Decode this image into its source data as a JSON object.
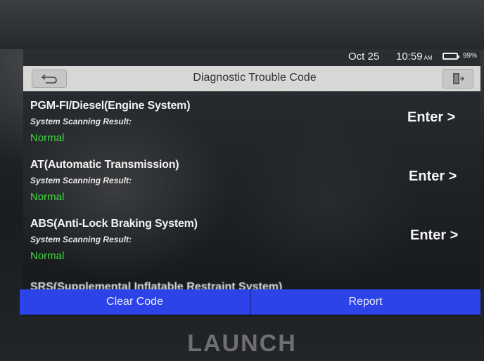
{
  "status_bar": {
    "date": "Oct 25",
    "time": "10:59",
    "ampm": "AM",
    "battery": "99%"
  },
  "header": {
    "title": "Diagnostic Trouble Code",
    "back_icon": "back-arrow-icon",
    "exit_icon": "exit-door-icon"
  },
  "systems": [
    {
      "name": "PGM-FI/Diesel(Engine System)",
      "scan_label": "System Scanning Result:",
      "result": "Normal",
      "action": "Enter >"
    },
    {
      "name": "AT(Automatic Transmission)",
      "scan_label": "System Scanning Result:",
      "result": "Normal",
      "action": "Enter >"
    },
    {
      "name": "ABS(Anti-Lock Braking System)",
      "scan_label": "System Scanning Result:",
      "result": "Normal",
      "action": "Enter >"
    }
  ],
  "partial_item": "SRS(Supplemental Inflatable Restraint System)",
  "actions": {
    "clear": "Clear Code",
    "report": "Report"
  },
  "brand": "LAUNCH",
  "colors": {
    "accent": "#2b43e8",
    "normal": "#3ddc3d",
    "title_bar": "#d7d7d6"
  }
}
